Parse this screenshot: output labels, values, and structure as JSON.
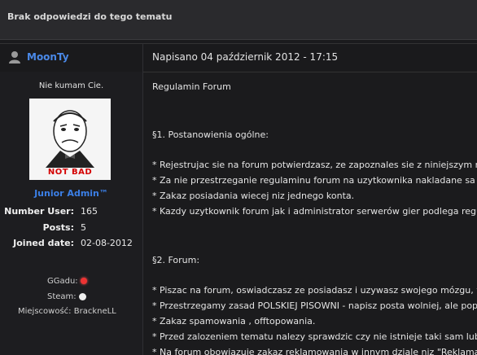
{
  "topic": {
    "title": "Brak odpowiedzi do tego tematu"
  },
  "post": {
    "username": "MoonTy",
    "posted": "Napisano 04 październik 2012 - 17:15"
  },
  "profile": {
    "status": "Nie kumam Cie.",
    "avatar_caption": "NOT BAD",
    "rank": "Junior Admin™",
    "stats": [
      {
        "label": "Number User:",
        "value": "165"
      },
      {
        "label": "Posts:",
        "value": "5"
      },
      {
        "label": "Joined date:",
        "value": "02-08-2012"
      }
    ],
    "ggadu_label": "GGadu:",
    "steam_label": "Steam:",
    "location_label": "Miejscowość:",
    "location_value": "BrackneLL"
  },
  "content": {
    "lines": [
      "Regulamin Forum",
      "§1. Postanowienia ogólne:",
      "* Rejestrujac sie na forum potwierdzasz, ze zapoznales sie z niniejszym regulaminem",
      "* Za nie przestrzeganie regulaminu forum na uzytkownika nakladane sa kary",
      "* Zakaz posiadania wiecej niz jednego konta.",
      "* Kazdy uzytkownik forum jak i administrator serwerów gier podlega regulaminowi",
      "§2. Forum:",
      "* Piszac na forum, oswiadczasz ze posiadasz i uzywasz swojego mózgu, w",
      "* Przestrzegamy zasad POLSKIEJ PISOWNI - napisz posta wolniej, ale poprawnie",
      "* Zakaz spamowania , offtopowania.",
      "* Przed zalozeniem tematu nalezy sprawdzic czy nie istnieje taki sam lub podobny",
      "* Na forum obowiazuje zakaz reklamowania w innym dziale niz \"Reklama\""
    ]
  },
  "colors": {
    "accent": "#3b7fe6",
    "username": "#4a89e8",
    "notbad": "#d40000"
  }
}
